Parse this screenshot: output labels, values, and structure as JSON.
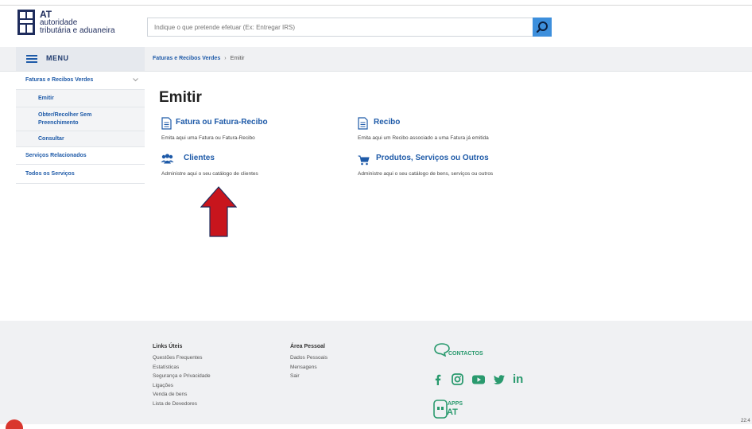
{
  "logo": {
    "line1": "AT",
    "line2": "autoridade",
    "line3": "tributária e aduaneira"
  },
  "search": {
    "placeholder": "Indique o que pretende efetuar (Ex: Entregar IRS)"
  },
  "menu": {
    "label": "MENU"
  },
  "breadcrumb": {
    "parent": "Faturas e Recibos Verdes",
    "separator": "›",
    "current": "Emitir"
  },
  "sidebar": {
    "section": "Faturas e Recibos Verdes",
    "items": [
      {
        "label": "Emitir"
      },
      {
        "label": "Obter/Recolher Sem Preenchimento"
      },
      {
        "label": "Consultar"
      }
    ],
    "related": "Serviços Relacionados",
    "all": "Todos os Serviços"
  },
  "main": {
    "title": "Emitir",
    "options": [
      {
        "label": "Fatura ou Fatura-Recibo",
        "description": "Emita aqui uma Fatura ou Fatura-Recibo"
      },
      {
        "label": "Recibo",
        "description": "Emita aqui um Recibo associado a uma Fatura já emitida"
      },
      {
        "label": "Clientes",
        "description": "Administre aqui o seu catálogo de clientes"
      },
      {
        "label": "Produtos, Serviços ou Outros",
        "description": "Administre aqui o seu catálogo de bens, serviços ou outros"
      }
    ]
  },
  "footer": {
    "links_title": "Links Úteis",
    "links": [
      "Questões Frequentes",
      "Estatísticas",
      "Segurança e Privacidade",
      "Ligações",
      "Venda de bens",
      "Lista de Devedores"
    ],
    "personal_title": "Área Pessoal",
    "personal": [
      "Dados Pessoais",
      "Mensagens",
      "Sair"
    ],
    "contacts_label": "CONTACTOS",
    "apps_label_1": "APPS",
    "apps_label_2": "AT",
    "social_linkedin": "in"
  },
  "corner_text": "22:4",
  "colors": {
    "brand": "#1e2c5c",
    "link": "#1e5aa8",
    "search_button": "#3d8fdc",
    "accent_green": "#2a9a6e",
    "arrow": "#c8151d"
  }
}
